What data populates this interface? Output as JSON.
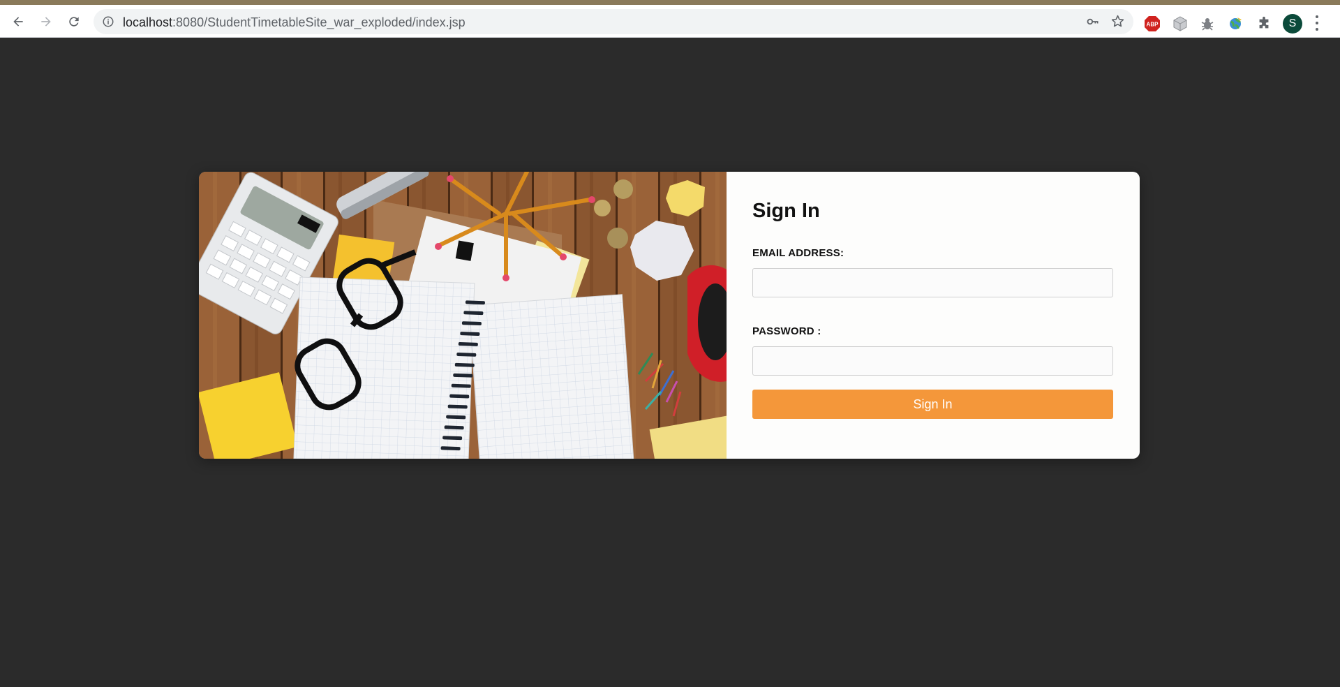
{
  "browser": {
    "url_host": "localhost",
    "url_path": ":8080/StudentTimetableSite_war_exploded/index.jsp",
    "abp_label": "ABP",
    "profile_initial": "S",
    "icons": [
      "back-icon",
      "forward-icon",
      "reload-icon",
      "info-icon",
      "key-icon",
      "star-icon",
      "adblock-icon",
      "cube-extension-icon",
      "bug-extension-icon",
      "globe-extension-icon",
      "puzzle-icon",
      "menu-icon"
    ]
  },
  "login": {
    "title": "Sign In",
    "email_label": "EMAIL ADDRESS:",
    "email_value": "",
    "password_label": "PASSWORD :",
    "password_value": "",
    "submit_label": "Sign In"
  },
  "colors": {
    "page_background": "#2b2b2b",
    "card_background": "#fdfdfc",
    "button_accent": "#f4973a",
    "avatar": "#0b4a3a"
  }
}
